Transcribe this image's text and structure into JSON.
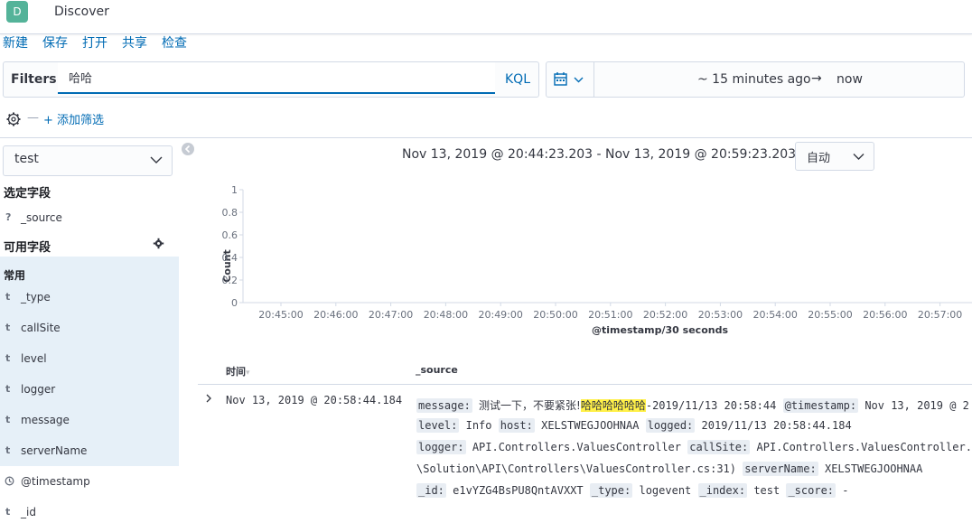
{
  "header": {
    "logo_letter": "D",
    "app_title": "Discover"
  },
  "top_menu": {
    "new": "新建",
    "save": "保存",
    "open": "打开",
    "share": "共享",
    "inspect": "检查"
  },
  "query_bar": {
    "filters_label": "Filters",
    "query_value": "哈哈",
    "language": "KQL"
  },
  "time_picker": {
    "start": "~ 15 minutes ago",
    "arrow": "→",
    "end": "now"
  },
  "filter_bar": {
    "add_filter": "+ 添加筛选",
    "separator": "—"
  },
  "sidebar": {
    "index_pattern": "test",
    "selected_fields_title": "选定字段",
    "selected_fields": [
      {
        "type": "?",
        "name": "_source"
      }
    ],
    "available_fields_title": "可用字段",
    "popular_title": "常用",
    "popular_fields": [
      {
        "type": "t",
        "name": "_type"
      },
      {
        "type": "t",
        "name": "callSite"
      },
      {
        "type": "t",
        "name": "level"
      },
      {
        "type": "t",
        "name": "logger"
      },
      {
        "type": "t",
        "name": "message"
      },
      {
        "type": "t",
        "name": "serverName"
      }
    ],
    "other_fields": [
      {
        "type": "clock",
        "name": "@timestamp"
      },
      {
        "type": "t",
        "name": "_id"
      }
    ]
  },
  "histogram": {
    "time_range": "Nov 13, 2019 @ 20:44:23.203 - Nov 13, 2019 @ 20:59:23.203 —",
    "interval": "自动"
  },
  "chart_data": {
    "type": "bar",
    "ylabel": "Count",
    "xlabel": "@timestamp/30 seconds",
    "ylim": [
      0,
      1
    ],
    "yticks": [
      "0",
      "0.2",
      "0.4",
      "0.6",
      "0.8",
      "1"
    ],
    "categories": [
      "20:45:00",
      "20:46:00",
      "20:47:00",
      "20:48:00",
      "20:49:00",
      "20:50:00",
      "20:51:00",
      "20:52:00",
      "20:53:00",
      "20:54:00",
      "20:55:00",
      "20:56:00",
      "20:57:00"
    ],
    "values": [
      0,
      0,
      0,
      0,
      0,
      0,
      0,
      0,
      0,
      0,
      0,
      0,
      0
    ],
    "grid": false
  },
  "table": {
    "col_time": "时间",
    "col_source": "_source",
    "rows": [
      {
        "time": "Nov 13, 2019 @ 20:58:44.184",
        "message_key": "message:",
        "message_pre": "测试一下，不要紧张!",
        "message_hl": "哈哈哈哈哈哈",
        "message_post": "-2019/11/13 20:58:44",
        "timestamp_key": "@timestamp:",
        "timestamp_val": "Nov 13, 2019 @ 2",
        "level_key": "level:",
        "level_val": "Info",
        "host_key": "host:",
        "host_val": "XELSTWEGJOOHNAA",
        "logged_key": "logged:",
        "logged_val": "2019/11/13 20:58:44.184",
        "logger_key": "logger:",
        "logger_val": "API.Controllers.ValuesController",
        "callsite_key": "callSite:",
        "callsite_val": "API.Controllers.ValuesController.G",
        "path_val": "\\Solution\\API\\Controllers\\ValuesController.cs:31)",
        "servername_key": "serverName:",
        "servername_val": "XELSTWEGJOOHNAA",
        "id_key": "_id:",
        "id_val": "e1vYZG4BsPU8QntAVXXT",
        "type_key": "_type:",
        "type_val": "logevent",
        "index_key": "_index:",
        "index_val": "test",
        "score_key": "_score:",
        "score_val": "-"
      }
    ]
  }
}
